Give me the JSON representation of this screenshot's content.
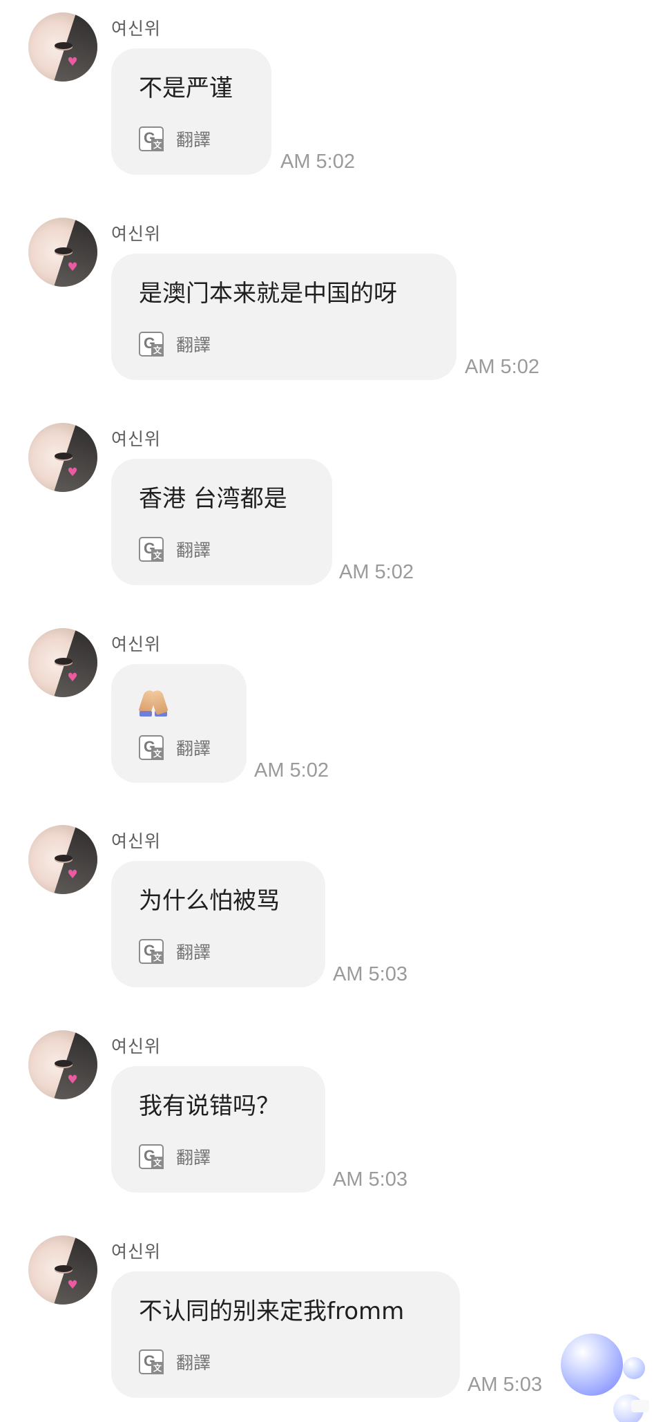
{
  "sender_name": "여신위",
  "translate_label": "翻譯",
  "messages": [
    {
      "text": "不是严谨",
      "time": "AM 5:02"
    },
    {
      "text": "是澳门本来就是中国的呀",
      "time": "AM 5:02"
    },
    {
      "text": "香港 台湾都是",
      "time": "AM 5:02"
    },
    {
      "text": "🙏",
      "time": "AM 5:02"
    },
    {
      "text": "为什么怕被骂",
      "time": "AM 5:03"
    },
    {
      "text": "我有说错吗？",
      "time": "AM 5:03"
    },
    {
      "text": "不认同的别来定我fromm",
      "time": "AM 5:03"
    }
  ],
  "icons": {
    "translate": "translate-icon",
    "avatar": "avatar-image",
    "floating_bubbles": "bubble-decoration-icon"
  },
  "colors": {
    "background": "#ffffff",
    "bubble": "#f2f2f2",
    "timestamp": "#9a9a9a"
  }
}
